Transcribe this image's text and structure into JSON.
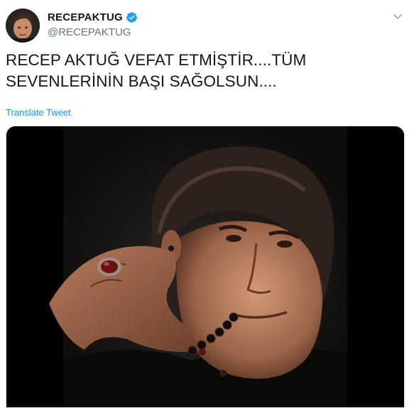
{
  "user": {
    "display_name": "RECEPAKTUG",
    "handle": "@RECEPAKTUG",
    "verified": true,
    "avatar_icon": "profile-photo"
  },
  "tweet": {
    "text": "RECEP AKTUĞ VEFAT ETMİŞTİR....TÜM SEVENLERİNİN BAŞI SAĞOLSUN....",
    "translate_label": "Translate Tweet"
  },
  "media": {
    "kind": "portrait-photo"
  },
  "menu": {
    "icon": "chevron-down-icon"
  },
  "colors": {
    "text": "#14171a",
    "secondary": "#657786",
    "link": "#1b95e0",
    "verified": "#1da1f2"
  }
}
